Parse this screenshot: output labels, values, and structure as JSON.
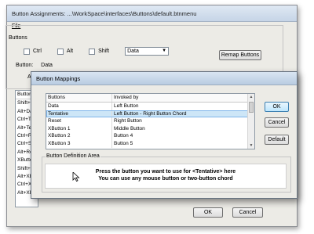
{
  "main_window": {
    "title": "Button Assignments: ...\\WorkSpace\\interfaces\\Buttons\\default.btnmenu",
    "menu": {
      "file": "File"
    },
    "buttons_group": {
      "label": "Buttons",
      "modifiers": {
        "ctrl": "Ctrl",
        "alt": "Alt",
        "shift": "Shift"
      },
      "mode_select_value": "Data",
      "remap_button": "Remap Buttons",
      "button_label": "Button:",
      "button_value": "Data",
      "stub_text": "Ac"
    },
    "left_list": [
      "Button",
      "Shift+D",
      "Alt+Da",
      "Ctrl+T",
      "Alt+Te",
      "Ctrl+Re",
      "Ctrl+Sh",
      "Alt+Re",
      "XButto",
      "Shift+X",
      "Alt+XB",
      "Ctrl+X",
      "Alt+XB"
    ],
    "ok_button": "OK",
    "cancel_button": "Cancel"
  },
  "dialog": {
    "title": "Button Mappings",
    "table": {
      "headers": [
        "Buttons",
        "Invoked by"
      ],
      "rows": [
        {
          "button": "Data",
          "invoked": "Left Button"
        },
        {
          "button": "Tentative",
          "invoked": "Left Button - Right Button Chord"
        },
        {
          "button": "Reset",
          "invoked": "Right Button"
        },
        {
          "button": "XButton 1",
          "invoked": "Middle Button"
        },
        {
          "button": "XButton 2",
          "invoked": "Button 4"
        },
        {
          "button": "XButton 3",
          "invoked": "Button 5"
        }
      ],
      "selected_index": 1
    },
    "ok_button": "OK",
    "cancel_button": "Cancel",
    "default_button": "Default",
    "definition_area": {
      "label": "Button Definition Area",
      "prompt_line1": "Press the button you want to use for <Tentative> here",
      "prompt_line2": "You can use any mouse button or two-button chord"
    }
  }
}
